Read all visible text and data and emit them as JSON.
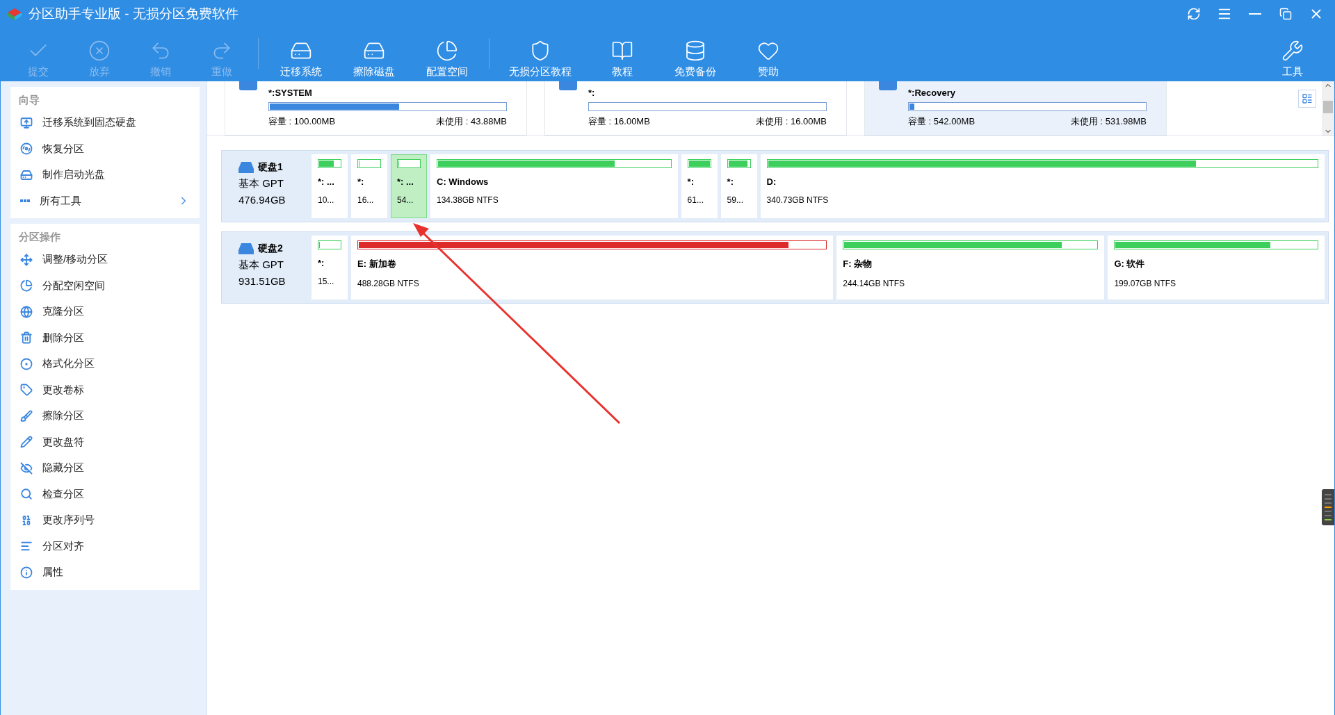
{
  "window": {
    "title": "分区助手专业版 - 无损分区免费软件"
  },
  "toolbar": [
    {
      "label": "提交",
      "disabled": true
    },
    {
      "label": "放弃",
      "disabled": true
    },
    {
      "label": "撤销",
      "disabled": true
    },
    {
      "label": "重做",
      "disabled": true
    },
    {
      "label": "迁移系统",
      "disabled": false
    },
    {
      "label": "擦除磁盘",
      "disabled": false
    },
    {
      "label": "配置空间",
      "disabled": false
    },
    {
      "label": "无损分区教程",
      "disabled": false
    },
    {
      "label": "教程",
      "disabled": false
    },
    {
      "label": "免费备份",
      "disabled": false
    },
    {
      "label": "赞助",
      "disabled": false
    },
    {
      "label": "工具",
      "disabled": false
    }
  ],
  "sidebar": [
    {
      "title": "向导",
      "items": [
        {
          "label": "迁移系统到固态硬盘",
          "has_submenu": false
        },
        {
          "label": "恢复分区",
          "has_submenu": false
        },
        {
          "label": "制作启动光盘",
          "has_submenu": false
        },
        {
          "label": "所有工具",
          "has_submenu": true
        }
      ]
    },
    {
      "title": "分区操作",
      "items": [
        {
          "label": "调整/移动分区",
          "has_submenu": false
        },
        {
          "label": "分配空闲空间",
          "has_submenu": false
        },
        {
          "label": "克隆分区",
          "has_submenu": false
        },
        {
          "label": "删除分区",
          "has_submenu": false
        },
        {
          "label": "格式化分区",
          "has_submenu": false
        },
        {
          "label": "更改卷标",
          "has_submenu": false
        },
        {
          "label": "擦除分区",
          "has_submenu": false
        },
        {
          "label": "更改盘符",
          "has_submenu": false
        },
        {
          "label": "隐藏分区",
          "has_submenu": false
        },
        {
          "label": "检查分区",
          "has_submenu": false
        },
        {
          "label": "更改序列号",
          "has_submenu": false
        },
        {
          "label": "分区对齐",
          "has_submenu": false
        },
        {
          "label": "属性",
          "has_submenu": false
        }
      ]
    }
  ],
  "partition_cards": [
    {
      "name": "*:SYSTEM",
      "level": 0.55,
      "capacity": "容量 : 100.00MB",
      "free": "未使用 : 43.88MB",
      "selected": false
    },
    {
      "name": "*:",
      "level": 0,
      "capacity": "容量 : 16.00MB",
      "free": "未使用 : 16.00MB",
      "selected": false
    },
    {
      "name": "*:Recovery",
      "level": 0.02,
      "capacity": "容量 : 542.00MB",
      "free": "未使用 : 531.98MB",
      "selected": true
    }
  ],
  "disks": [
    {
      "name": "硬盘1",
      "type": "基本 GPT",
      "size": "476.94GB",
      "partitions": [
        {
          "name": "*: ...",
          "info": "10...",
          "level": 0.7,
          "color": "#3ccf5c",
          "selected": false
        },
        {
          "name": "*:",
          "info": "16...",
          "level": 0,
          "color": "#3ccf5c",
          "selected": false
        },
        {
          "name": "*: ...",
          "info": "54...",
          "level": 0,
          "color": "#3ccf5c",
          "selected": true
        },
        {
          "name": "C: Windows",
          "info": "134.38GB NTFS",
          "level": 0.76,
          "color": "#3ccf5c",
          "selected": false
        },
        {
          "name": "*:",
          "info": "61...",
          "level": 1,
          "color": "#3ccf5c",
          "selected": false
        },
        {
          "name": "*:",
          "info": "59...",
          "level": 0.92,
          "color": "#3ccf5c",
          "selected": false
        },
        {
          "name": "D:",
          "info": "340.73GB NTFS",
          "level": 0.78,
          "color": "#3ccf5c",
          "selected": false
        }
      ]
    },
    {
      "name": "硬盘2",
      "type": "基本 GPT",
      "size": "931.51GB",
      "partitions": [
        {
          "name": "*:",
          "info": "15...",
          "level": 0,
          "color": "#3ccf5c",
          "selected": false
        },
        {
          "name": "E: 新加卷",
          "info": "488.28GB NTFS",
          "level": 0.92,
          "color": "#dd2a2a",
          "selected": false
        },
        {
          "name": "F: 杂物",
          "info": "244.14GB NTFS",
          "level": 0.86,
          "color": "#3ccf5c",
          "selected": false
        },
        {
          "name": "G: 软件",
          "info": "199.07GB NTFS",
          "level": 0.77,
          "color": "#3ccf5c",
          "selected": false
        }
      ]
    }
  ]
}
